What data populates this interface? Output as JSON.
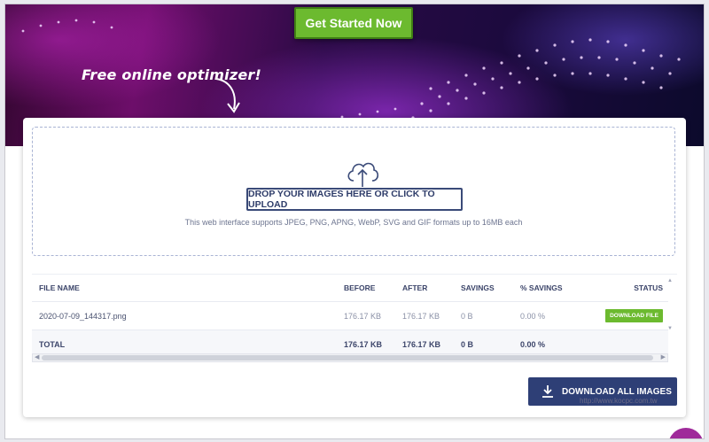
{
  "hero": {
    "cta_label": "Get Started Now",
    "tagline": "Free online optimizer!"
  },
  "dropzone": {
    "upload_label": "DROP YOUR IMAGES HERE OR CLICK TO UPLOAD",
    "support_text": "This web interface supports JPEG, PNG, APNG, WebP, SVG and GIF formats up to 16MB each",
    "icon": "cloud-upload-icon"
  },
  "table": {
    "headers": [
      "FILE NAME",
      "BEFORE",
      "AFTER",
      "SAVINGS",
      "% SAVINGS",
      "STATUS"
    ],
    "rows": [
      {
        "name": "2020-07-09_144317.png",
        "before": "176.17 KB",
        "after": "176.17 KB",
        "savings": "0 B",
        "pct": "0.00 %",
        "status": "DOWNLOAD FILE"
      }
    ],
    "total": {
      "name": "TOTAL",
      "before": "176.17 KB",
      "after": "176.17 KB",
      "savings": "0 B",
      "pct": "0.00 %"
    }
  },
  "download_all_label": "DOWNLOAD ALL IMAGES",
  "watermark": "http://www.kocpc.com.tw",
  "colors": {
    "accent_green": "#6cba2f",
    "navy": "#2e3f76",
    "hero_purple": "#6d0e6a"
  }
}
